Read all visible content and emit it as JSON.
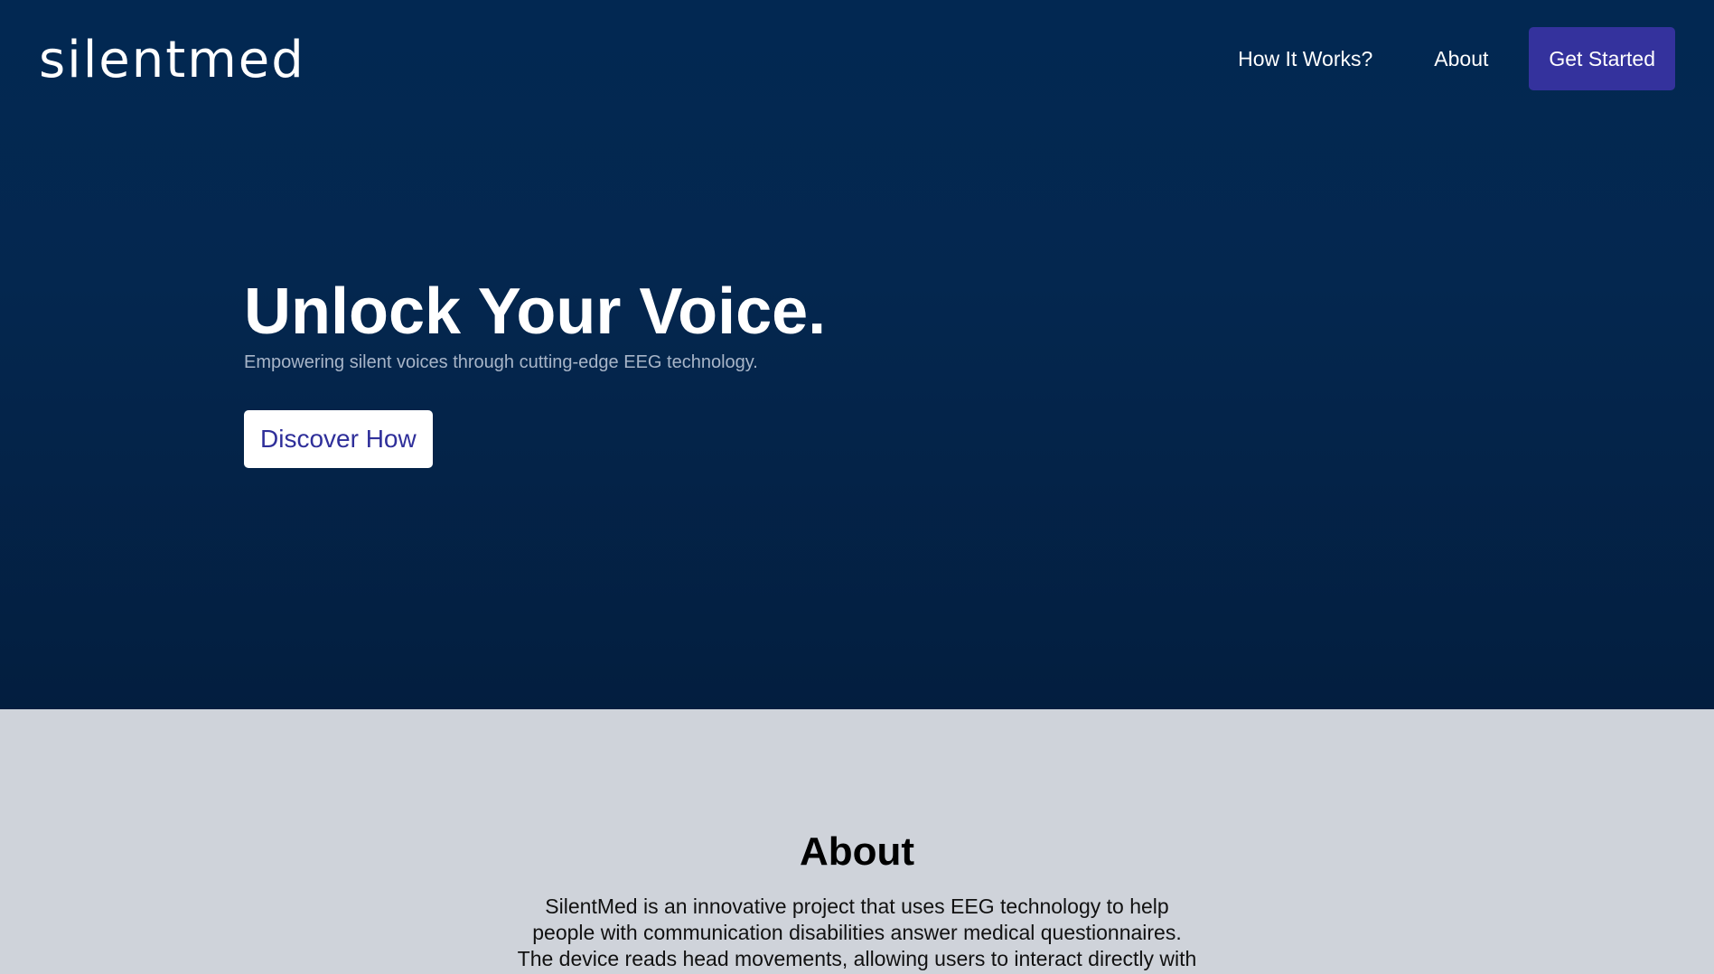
{
  "nav": {
    "logo": "silentmed",
    "links": [
      "How It Works?",
      "About"
    ],
    "cta": "Get Started"
  },
  "hero": {
    "title": "Unlock Your Voice.",
    "subtitle": "Empowering silent voices through cutting-edge EEG technology.",
    "button": "Discover How"
  },
  "about": {
    "title": "About",
    "text": "SilentMed is an innovative project that uses EEG technology to help people with communication disabilities answer medical questionnaires. The device reads head movements, allowing users to interact directly with questions"
  },
  "colors": {
    "hero_bg": "#022852",
    "cta_bg": "#34329d",
    "about_bg": "#cfd3da",
    "discover_text": "#2f2f9a"
  }
}
